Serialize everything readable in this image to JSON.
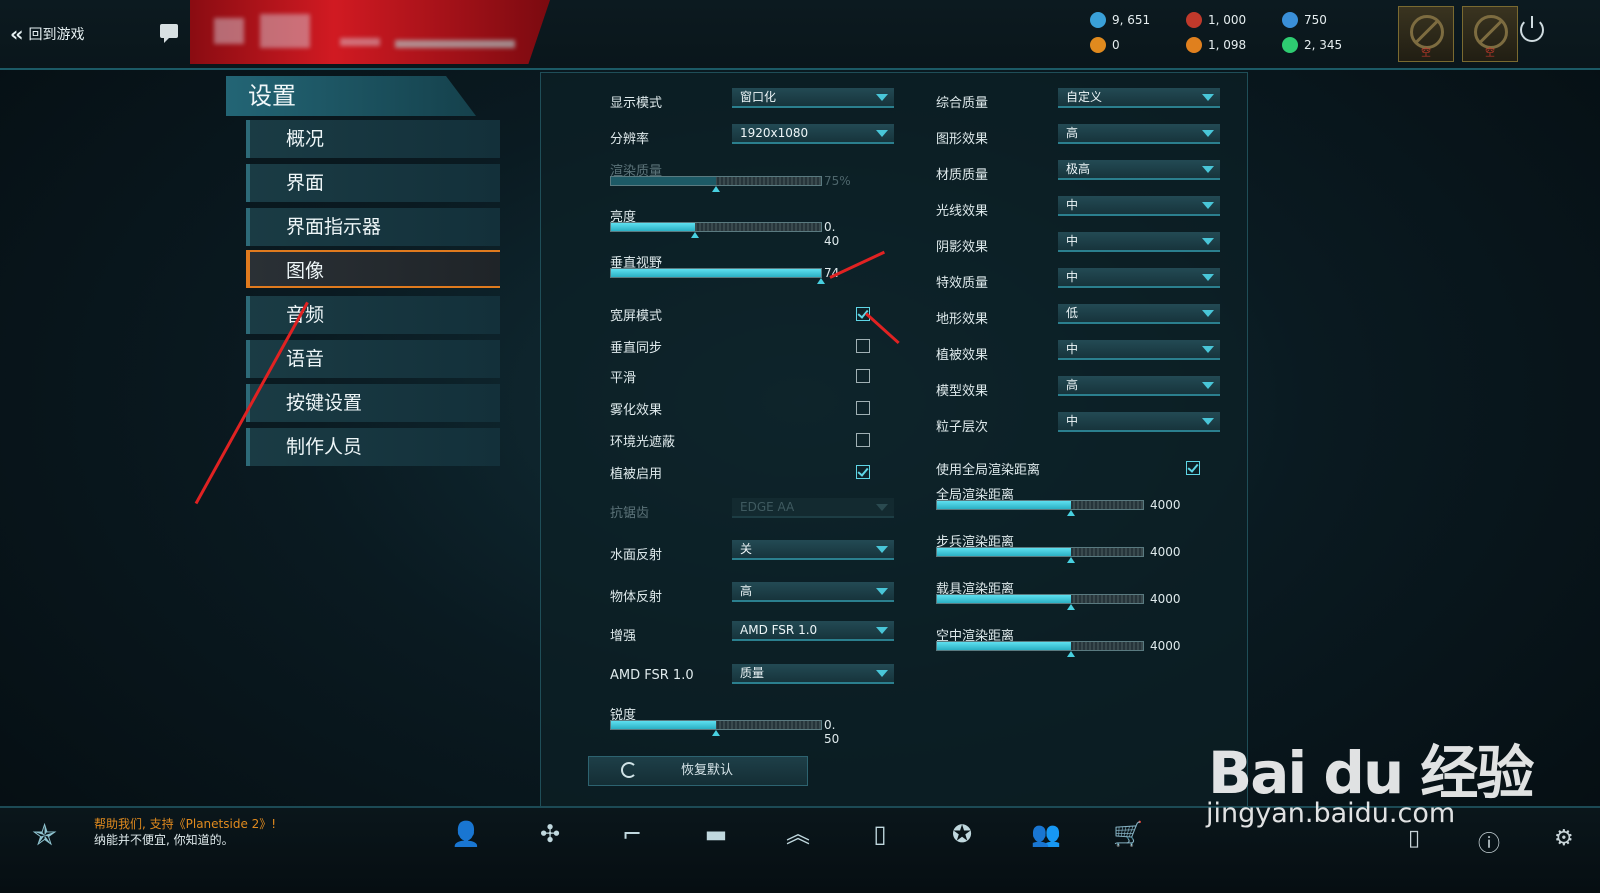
{
  "topbar": {
    "back_label": "回到游戏",
    "resources": [
      {
        "icon": "cert-icon",
        "value": "9, 651",
        "color": "#3aa0d8"
      },
      {
        "icon": "nanite-icon",
        "value": "1, 000",
        "color": "#c0392b"
      },
      {
        "icon": "orb-icon",
        "value": "750",
        "color": "#3a8fd8"
      },
      {
        "icon": "daybreak-cash-icon",
        "value": "0",
        "color": "#e08a1e"
      },
      {
        "icon": "boost-icon",
        "value": "1, 098",
        "color": "#e0801e"
      },
      {
        "icon": "recon-icon",
        "value": "2, 345",
        "color": "#2ecc71"
      }
    ],
    "slot_labels": [
      "空",
      "空"
    ]
  },
  "nav": {
    "title": "设置",
    "items": [
      "概况",
      "界面",
      "界面指示器",
      "图像",
      "音频",
      "语音",
      "按键设置",
      "制作人员"
    ],
    "active": 3
  },
  "left_col": {
    "display_mode": {
      "label": "显示模式",
      "value": "窗口化"
    },
    "resolution": {
      "label": "分辨率",
      "value": "1920x1080"
    },
    "render_quality": {
      "label": "渲染质量",
      "value": "75%",
      "level": 0.5
    },
    "brightness": {
      "label": "亮度",
      "value": "0. 40",
      "level": 0.4
    },
    "vertical_fov": {
      "label": "垂直视野",
      "value": "74",
      "level": 1.0
    },
    "widescreen": {
      "label": "宽屏模式",
      "checked": true
    },
    "vsync": {
      "label": "垂直同步",
      "checked": false
    },
    "smooth": {
      "label": "平滑",
      "checked": false
    },
    "fog": {
      "label": "雾化效果",
      "checked": false
    },
    "ambient_occlusion": {
      "label": "环境光遮蔽",
      "checked": false
    },
    "foliage_enabled": {
      "label": "植被启用",
      "checked": true
    },
    "antialias": {
      "label": "抗锯齿",
      "value": "EDGE AA"
    },
    "water_reflection": {
      "label": "水面反射",
      "value": "关"
    },
    "object_reflection": {
      "label": "物体反射",
      "value": "高"
    },
    "enhance": {
      "label": "增强",
      "value": "AMD FSR 1.0"
    },
    "fsr": {
      "label": "AMD FSR 1.0",
      "value": "质量"
    },
    "sharpness": {
      "label": "锐度",
      "value": "0. 50",
      "level": 0.5
    }
  },
  "right_col": {
    "dropdowns": [
      {
        "label": "综合质量",
        "value": "自定义"
      },
      {
        "label": "图形效果",
        "value": "高"
      },
      {
        "label": "材质质量",
        "value": "极高"
      },
      {
        "label": "光线效果",
        "value": "中"
      },
      {
        "label": "阴影效果",
        "value": "中"
      },
      {
        "label": "特效质量",
        "value": "中"
      },
      {
        "label": "地形效果",
        "value": "低"
      },
      {
        "label": "植被效果",
        "value": "中"
      },
      {
        "label": "模型效果",
        "value": "高"
      },
      {
        "label": "粒子层次",
        "value": "中"
      }
    ],
    "global_render": {
      "label": "使用全局渲染距离",
      "checked": true
    },
    "sliders": [
      {
        "label": "全局渲染距离",
        "value": "4000",
        "level": 0.65
      },
      {
        "label": "步兵渲染距离",
        "value": "4000",
        "level": 0.65
      },
      {
        "label": "载具渲染距离",
        "value": "4000",
        "level": 0.65
      },
      {
        "label": "空中渲染距离",
        "value": "4000",
        "level": 0.65
      }
    ]
  },
  "reset_label": "恢复默认",
  "bottom": {
    "help_line1": "帮助我们, 支持《Planetside 2》!",
    "help_line2": "纳能并不便宜, 你知道的。"
  },
  "watermark": {
    "brand": "Bai du 经验",
    "url": "jingyan.baidu.com"
  },
  "colors": {
    "accent": "#49c6d8",
    "active_nav": "#e07a1e",
    "annotation": "#e02222"
  }
}
